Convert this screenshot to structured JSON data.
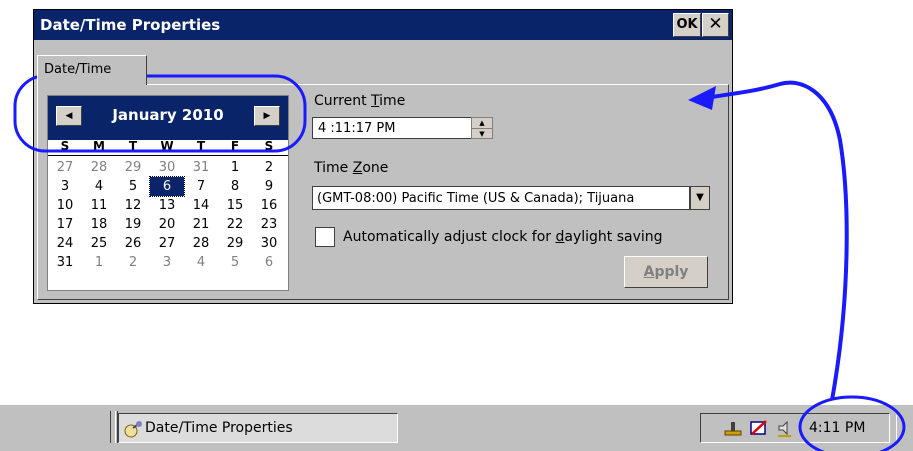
{
  "window": {
    "title": "Date/Time Properties",
    "ok_label": "OK",
    "close_label": "✕"
  },
  "tabs": [
    {
      "label": "Date/Time",
      "active": true
    }
  ],
  "calendar": {
    "month_year": "January 2010",
    "weekdays": [
      "S",
      "M",
      "T",
      "W",
      "T",
      "F",
      "S"
    ],
    "days": [
      {
        "d": "27",
        "o": 1
      },
      {
        "d": "28",
        "o": 1
      },
      {
        "d": "29",
        "o": 1
      },
      {
        "d": "30",
        "o": 1
      },
      {
        "d": "31",
        "o": 1
      },
      {
        "d": "1"
      },
      {
        "d": "2"
      },
      {
        "d": "3"
      },
      {
        "d": "4"
      },
      {
        "d": "5"
      },
      {
        "d": "6",
        "sel": 1
      },
      {
        "d": "7"
      },
      {
        "d": "8"
      },
      {
        "d": "9"
      },
      {
        "d": "10"
      },
      {
        "d": "11"
      },
      {
        "d": "12"
      },
      {
        "d": "13"
      },
      {
        "d": "14"
      },
      {
        "d": "15"
      },
      {
        "d": "16"
      },
      {
        "d": "17"
      },
      {
        "d": "18"
      },
      {
        "d": "19"
      },
      {
        "d": "20"
      },
      {
        "d": "21"
      },
      {
        "d": "22"
      },
      {
        "d": "23"
      },
      {
        "d": "24"
      },
      {
        "d": "25"
      },
      {
        "d": "26"
      },
      {
        "d": "27"
      },
      {
        "d": "28"
      },
      {
        "d": "29"
      },
      {
        "d": "30"
      },
      {
        "d": "31"
      },
      {
        "d": "1",
        "o": 1
      },
      {
        "d": "2",
        "o": 1
      },
      {
        "d": "3",
        "o": 1
      },
      {
        "d": "4",
        "o": 1
      },
      {
        "d": "5",
        "o": 1
      },
      {
        "d": "6",
        "o": 1
      }
    ],
    "selected_day": "6"
  },
  "current_time": {
    "label_pre": "Current ",
    "label_u": "T",
    "label_post": "ime",
    "value": "4 :11:17 PM"
  },
  "time_zone": {
    "label_pre": "Time ",
    "label_u": "Z",
    "label_post": "one",
    "value": "(GMT-08:00) Pacific Time (US & Canada); Tijuana"
  },
  "daylight": {
    "label_pre": "Automatically adjust clock for ",
    "label_u": "d",
    "label_post": "aylight saving",
    "checked": false
  },
  "apply": {
    "label_u": "A",
    "label_post": "pply",
    "enabled": false
  },
  "taskbar": {
    "task_label": "Date/Time Properties",
    "clock": "4:11 PM"
  },
  "colors": {
    "titlebar": "#0a246a",
    "face": "#c0c0c0",
    "annotation": "#1a1aff"
  }
}
